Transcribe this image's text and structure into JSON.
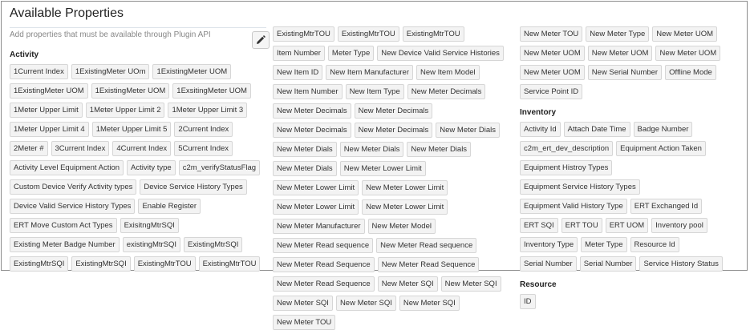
{
  "title": "Available Properties",
  "hint": "Add properties that must be available through Plugin API",
  "edit_icon": "pencil-icon",
  "columns": [
    {
      "groups": [
        {
          "heading": "Activity",
          "tags": [
            "1Current Index",
            "1ExistingMeter UOm",
            "1ExistingMeter UOM",
            "1ExistingMeter UOM",
            "1ExistingMeter UOM",
            "1ExsitingMeter UOM",
            "1Meter Upper Limit",
            "1Meter Upper Limit 2",
            "1Meter Upper Limit 3",
            "1Meter Upper Limit 4",
            "1Meter Upper Limit 5",
            "2Current Index",
            "2Meter #",
            "3Current Index",
            "4Current Index",
            "5Current Index",
            "Activity Level Equipment Action",
            "Activity type",
            "c2m_verifyStatusFlag",
            "Custom Device Verify Activity types",
            "Device Service History Types",
            "Device Valid Service History Types",
            "Enable Register",
            "ERT Move Custom Act Types",
            "ExisitngMtrSQI",
            "Existing Meter Badge Number",
            "existingMtrSQI",
            "ExistingMtrSQI",
            "ExistingMtrSQI",
            "ExistingMtrSQI",
            "ExistingMtrTOU",
            "ExistingMtrTOU"
          ]
        }
      ]
    },
    {
      "groups": [
        {
          "heading": "",
          "tags": [
            "ExistingMtrTOU",
            "ExistingMtrTOU",
            "ExistingMtrTOU",
            "Item Number",
            "Meter Type",
            "New Device Valid Service Histories",
            "New Item ID",
            "New Item Manufacturer",
            "New Item Model",
            "New Item Number",
            "New Item Type",
            "New Meter Decimals",
            "New Meter Decimals",
            "New Meter Decimals",
            "New Meter Decimals",
            "New Meter Decimals",
            "New Meter Dials",
            "New Meter Dials",
            "New Meter Dials",
            "New Meter Dials",
            "New Meter Dials",
            "New Meter Lower Limit",
            "New Meter Lower Limit",
            "New Meter Lower Limit",
            "New Meter Lower Limit",
            "New Meter Lower Limit",
            "New Meter Manufacturer",
            "New Meter Model",
            "New Meter Read sequence",
            "New Meter Read sequence",
            "New Meter Read Sequence",
            "New Meter Read Sequence",
            "New Meter Read Sequence",
            "New Meter SQI",
            "New Meter SQI",
            "New Meter SQI",
            "New Meter SQI",
            "New Meter SQI",
            "New Meter TOU"
          ]
        }
      ]
    },
    {
      "groups": [
        {
          "heading": "",
          "tags": [
            "New Meter TOU",
            "New Meter Type",
            "New Meter UOM",
            "New Meter UOM",
            "New Meter UOM",
            "New Meter UOM",
            "New Meter UOM",
            "New Serial Number",
            "Offline Mode",
            "Service Point ID"
          ]
        },
        {
          "heading": "Inventory",
          "tags": [
            "Activity Id",
            "Attach Date Time",
            "Badge Number",
            "c2m_ert_dev_description",
            "Equipment Action Taken",
            "Equipment Histroy Types",
            "Equipment Service History Types",
            "Equipment Valid History Type",
            "ERT Exchanged Id",
            "ERT SQI",
            "ERT TOU",
            "ERT UOM",
            "Inventory pool",
            "Inventory Type",
            "Meter Type",
            "Resource Id",
            "Serial Number",
            "Serial Number",
            "Service History Status"
          ]
        },
        {
          "heading": "Resource",
          "tags": [
            "ID"
          ]
        }
      ]
    }
  ]
}
